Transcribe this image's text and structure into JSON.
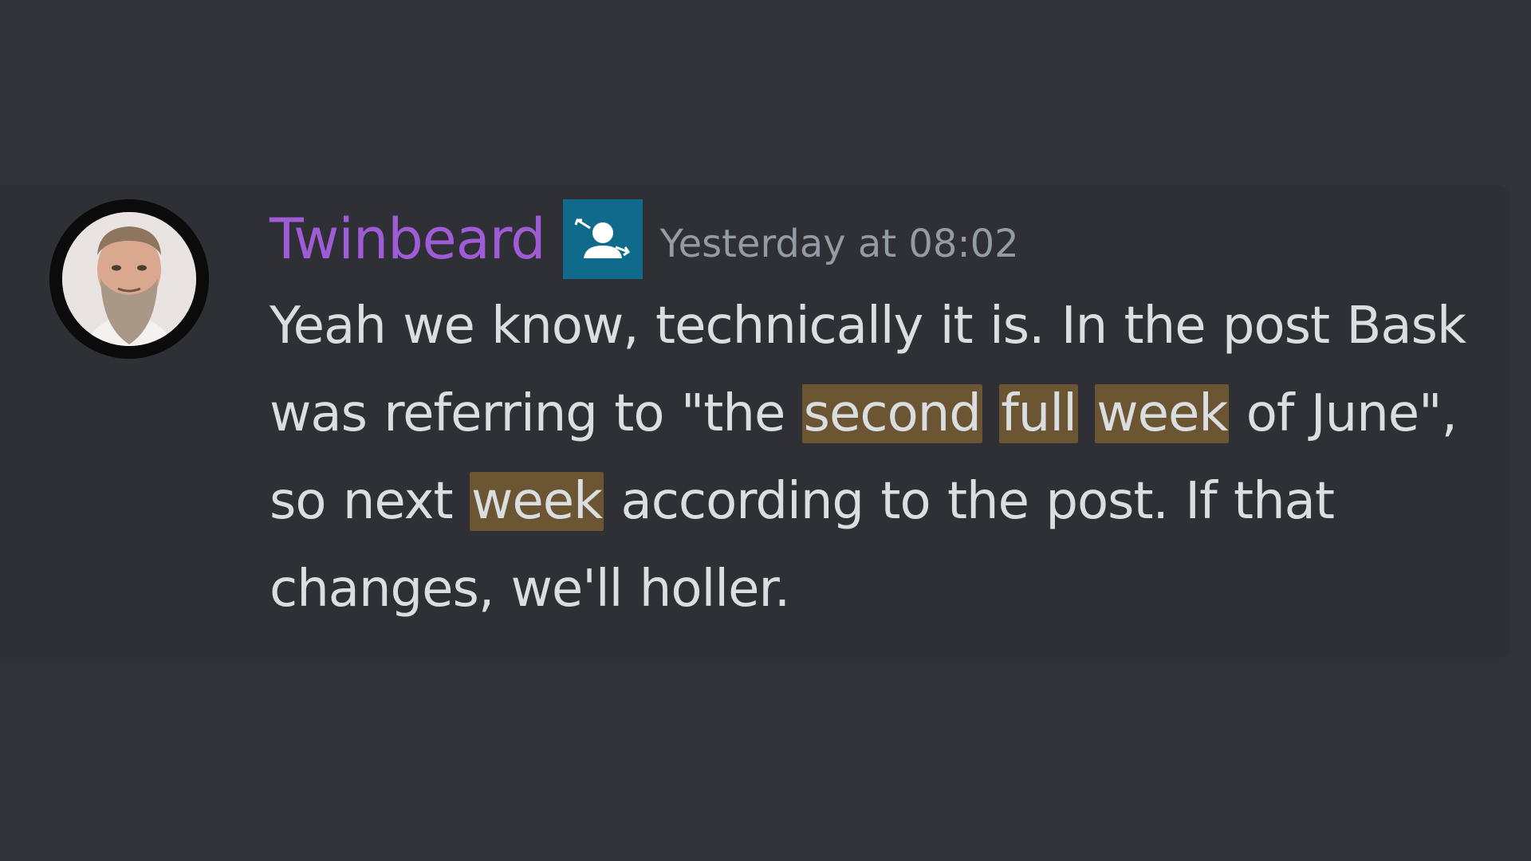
{
  "message": {
    "author": "Twinbeard",
    "author_color": "#a05cd6",
    "badge_icon": "role-badge-person-arrows-icon",
    "badge_color": "#0f6a8b",
    "timestamp": "Yesterday at 08:02",
    "avatar_icon": "user-avatar-bearded-man",
    "highlight_color": "#6b5533",
    "segments": {
      "s1": "Yeah we know, technically it is. In the post Bask was referring to \"the ",
      "h1": "second",
      "s2": " ",
      "h2": "full",
      "s3": " ",
      "h3": "week",
      "s4": " of June\", so next ",
      "h4": "week",
      "s5": " according to the post. If that changes, we'll holler."
    }
  }
}
